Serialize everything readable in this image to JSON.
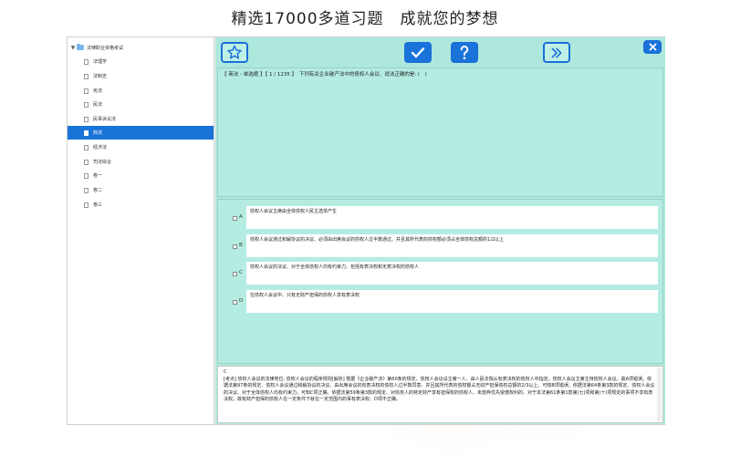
{
  "headline": "精选17000多道习题　成就您的梦想",
  "sidebar": {
    "root": "法律职业资格考试",
    "items": [
      {
        "label": "法理学",
        "selected": false
      },
      {
        "label": "法制史",
        "selected": false
      },
      {
        "label": "宪法",
        "selected": false
      },
      {
        "label": "民法",
        "selected": false
      },
      {
        "label": "民事诉讼法",
        "selected": false
      },
      {
        "label": "商法",
        "selected": true
      },
      {
        "label": "经济法",
        "selected": false
      },
      {
        "label": "司法综合",
        "selected": false
      },
      {
        "label": "卷一",
        "selected": false
      },
      {
        "label": "卷二",
        "selected": false
      },
      {
        "label": "卷三",
        "selected": false
      }
    ]
  },
  "toolbar": {
    "icons": [
      "star-icon",
      "checkmark-icon",
      "question-icon",
      "double-chevron-right-icon",
      "close-icon"
    ]
  },
  "question": {
    "text": "【 商法 - 单选题 】【 1 / 1235 】　下列有关企业破产法中的债权人会议、说法正确的是: (　)"
  },
  "options": [
    {
      "letter": "A",
      "text": "债权人会议主席由全体债权人民主选举产生"
    },
    {
      "letter": "B",
      "text": "债权人会议通过和解协议的决议、必须由出席会议的债权人过半数通过、并且其所代表的债权额必须占全体债权总额的1/2以上"
    },
    {
      "letter": "C",
      "text": "债权人会议的决议、对于全体债权人均有约束力、包括有表决权和无表决权的债权人"
    },
    {
      "letter": "D",
      "text": "在债权人会议中、只有无财产担保的债权人享有表决权"
    }
  ],
  "answer": {
    "label": "C",
    "text": "[考点] 债权人会议的法律地位: 债权人会议的程序规则[解析] 根据《企业破产法》第60条的规定、债权人会议设主席一人、由人民法院从有表决权的债权人中指定。债权人会议主席主持债权人会议。故A项错误。依据法第97条的规定、债权人会议通过和解协议的决议、由出席会议的有表决权的债权人过半数同意、并且其所代表的债权额占无财产担保债权总额的2/3以上。可知B项错误。依据法第64条第3款的规定、债权人会议的决议、对于全体债权人均有约束力。可知C项正确。依据法第59条第3款的规定、对债务人的特定财产享有担保权的债权人、未放弃优先受偿权利的、对于本法第61条第1款第(七)项和第(十)项规定的事项不享有表决权。故有财产担保的债权人在一定条件下就在一定范围内的事有表决权、D项不正确。"
  },
  "colors": {
    "accent": "#1a73d9",
    "panel": "#b4ece2",
    "main": "#aee8dd",
    "selected_row": "#1a73d9"
  }
}
